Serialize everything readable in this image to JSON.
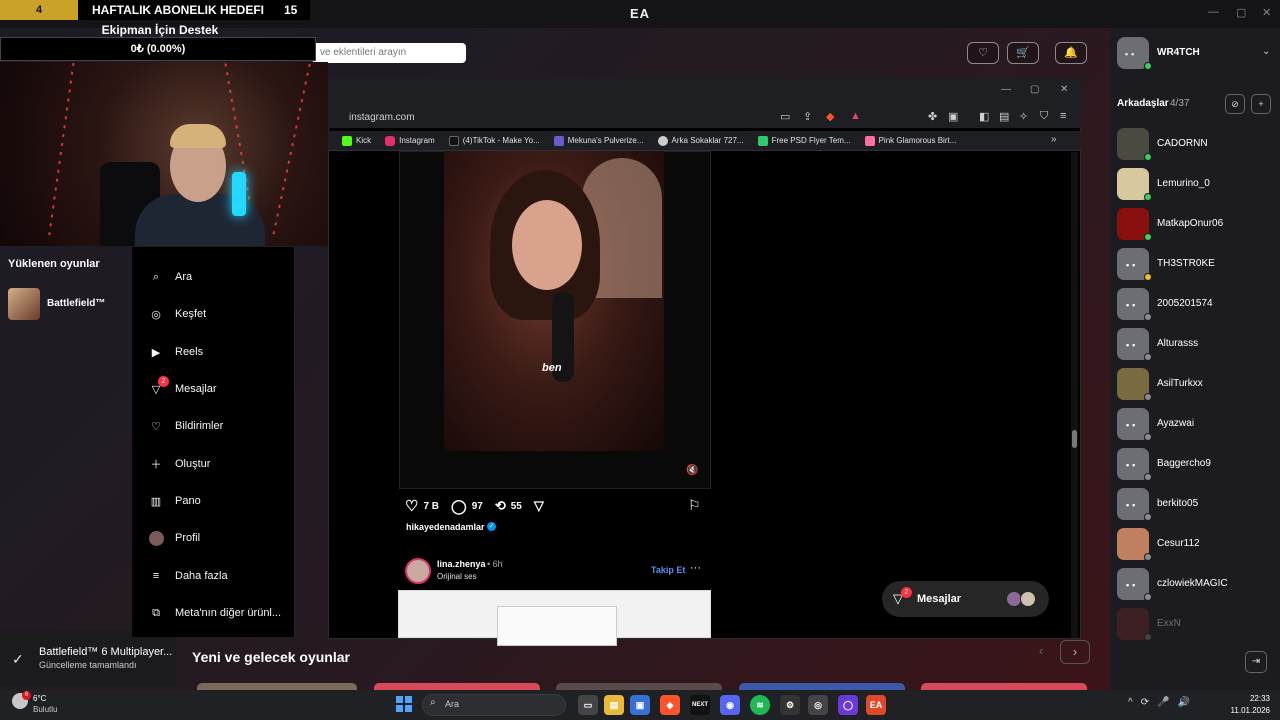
{
  "ea": {
    "title": "EA",
    "search_placeholder": "ve eklentileri arayın",
    "loaded_games_title": "Yüklenen oyunlar",
    "loaded_game": "Battlefield™",
    "update_toast": {
      "name": "Battlefield™ 6 Multiplayer...",
      "status": "Güncelleme tamamlandı"
    },
    "new_games_title": "Yeni ve gelecek oyunlar"
  },
  "overlay": {
    "sub_progress": "4",
    "sub_title": "HAFTALIK ABONELIK HEDEFI",
    "sub_count": "15",
    "donate_title": "Ekipman İçin Destek",
    "donate_value": "0₺ (0.00%)"
  },
  "browser": {
    "url": "instagram.com",
    "bookmarks": [
      "Kick",
      "Instagram",
      "(4)TikTok - Make Yo...",
      "Mekuna's Pulverize...",
      "Arka Sokaklar 727...",
      "Free PSD Flyer Tem...",
      "Pink Glamorous Birt..."
    ]
  },
  "instagram": {
    "nav": {
      "search": "Ara",
      "explore": "Keşfet",
      "reels": "Reels",
      "messages": "Mesajlar",
      "messages_badge": "2",
      "notifications": "Bildirimler",
      "create": "Oluştur",
      "dashboard": "Pano",
      "profile": "Profil",
      "more": "Daha fazla",
      "meta": "Meta'nın diğer ürünl..."
    },
    "reel_caption": "ben",
    "likes": "7 B",
    "comments": "97",
    "reposts": "55",
    "author": "hikayedenadamlar",
    "post2": {
      "user": "lina.zhenya",
      "time": "• 6h",
      "subtitle": "Orijinal ses",
      "follow": "Takip Et"
    },
    "messages_pill": "Mesajlar",
    "messages_pill_badge": "2"
  },
  "friends": {
    "me": "WR4TCH",
    "title": "Arkadaşlar",
    "count": "4/37",
    "list": [
      {
        "name": "CADORNN",
        "status": "online"
      },
      {
        "name": "Lemurino_0",
        "status": "online"
      },
      {
        "name": "MatkapOnur06",
        "status": "online"
      },
      {
        "name": "TH3STR0KE",
        "status": "away"
      },
      {
        "name": "2005201574",
        "status": "offline"
      },
      {
        "name": "Alturasss",
        "status": "offline"
      },
      {
        "name": "AsilTurkxx",
        "status": "offline"
      },
      {
        "name": "Ayazwai",
        "status": "offline"
      },
      {
        "name": "Baggercho9",
        "status": "offline"
      },
      {
        "name": "berkito05",
        "status": "offline"
      },
      {
        "name": "Cesur112",
        "status": "offline"
      },
      {
        "name": "czlowiekMAGIC",
        "status": "offline"
      },
      {
        "name": "ExxN",
        "status": "offline"
      }
    ]
  },
  "taskbar": {
    "temp": "6°C",
    "condition": "Bulutlu",
    "weather_badge": "6",
    "search": "Ara",
    "time": "22:33",
    "date": "11.01.2026"
  },
  "colors": {
    "online": "#3ad15a",
    "away": "#e8c02a",
    "offline": "#8a8a8f",
    "ig_badge": "#ff3040",
    "follow": "#5a8dee"
  }
}
